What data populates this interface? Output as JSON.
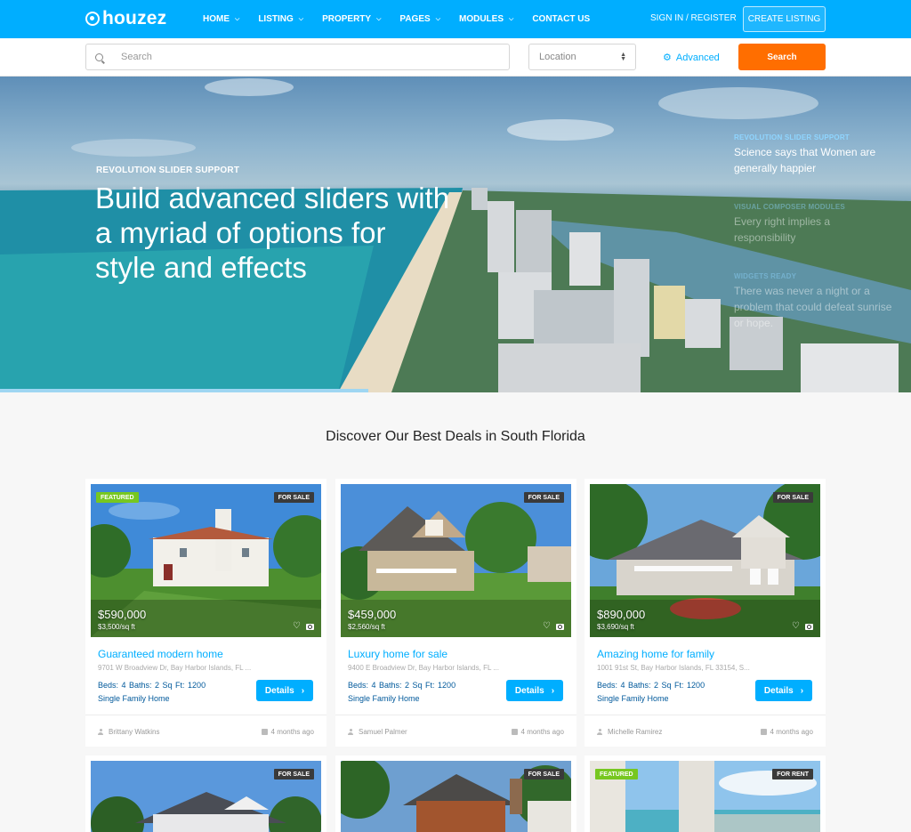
{
  "header": {
    "logo": "houzez",
    "nav": [
      {
        "label": "HOME",
        "chevron": true
      },
      {
        "label": "LISTING",
        "chevron": true
      },
      {
        "label": "PROPERTY",
        "chevron": true
      },
      {
        "label": "PAGES",
        "chevron": true
      },
      {
        "label": "MODULES",
        "chevron": true
      },
      {
        "label": "CONTACT US",
        "chevron": false
      }
    ],
    "signin": "SIGN IN / REGISTER",
    "create_listing": "CREATE LISTING"
  },
  "searchbar": {
    "placeholder": "Search",
    "location": "Location",
    "advanced": "Advanced",
    "search_button": "Search"
  },
  "hero": {
    "kicker": "REVOLUTION SLIDER SUPPORT",
    "title": "Build advanced sliders with a myriad of options for style and effects",
    "slides": [
      {
        "kicker": "REVOLUTION SLIDER SUPPORT",
        "text": "Science says that Women are generally happier"
      },
      {
        "kicker": "VISUAL COMPOSER MODULES",
        "text": "Every right implies a responsibility"
      },
      {
        "kicker": "WIDGETS READY",
        "text": "There was never a night or a problem that could defeat sunrise or hope."
      }
    ]
  },
  "section": {
    "title": "Discover Our Best Deals in South Florida"
  },
  "cards": [
    {
      "featured": "FEATURED",
      "status": "FOR SALE",
      "price": "$590,000",
      "sqft": "$3,500/sq ft",
      "title": "Guaranteed modern home",
      "address": "9701 W Broadview Dr, Bay Harbor Islands, FL ...",
      "specs": "Beds: 4  Baths: 2  Sq Ft: 1200",
      "type": "Single Family Home",
      "details": "Details",
      "agent": "Brittany Watkins",
      "date": "4 months ago"
    },
    {
      "featured": "",
      "status": "FOR SALE",
      "price": "$459,000",
      "sqft": "$2,560/sq ft",
      "title": "Luxury home for sale",
      "address": "9400 E Broadview Dr, Bay Harbor Islands, FL ...",
      "specs": "Beds: 4  Baths: 2  Sq Ft: 1200",
      "type": "Single Family Home",
      "details": "Details",
      "agent": "Samuel Palmer",
      "date": "4 months ago"
    },
    {
      "featured": "",
      "status": "FOR SALE",
      "price": "$890,000",
      "sqft": "$3,690/sq ft",
      "title": "Amazing home for family",
      "address": "1001 91st St, Bay Harbor Islands, FL 33154, S...",
      "specs": "Beds: 4  Baths: 2  Sq Ft: 1200",
      "type": "Single Family Home",
      "details": "Details",
      "agent": "Michelle Ramirez",
      "date": "4 months ago"
    },
    {
      "featured": "",
      "status": "FOR SALE"
    },
    {
      "featured": "",
      "status": "FOR SALE"
    },
    {
      "featured": "FEATURED",
      "status": "FOR RENT"
    }
  ],
  "colors": {
    "brand": "#00aeff",
    "search": "#ff6e00",
    "featured": "#77c720"
  }
}
